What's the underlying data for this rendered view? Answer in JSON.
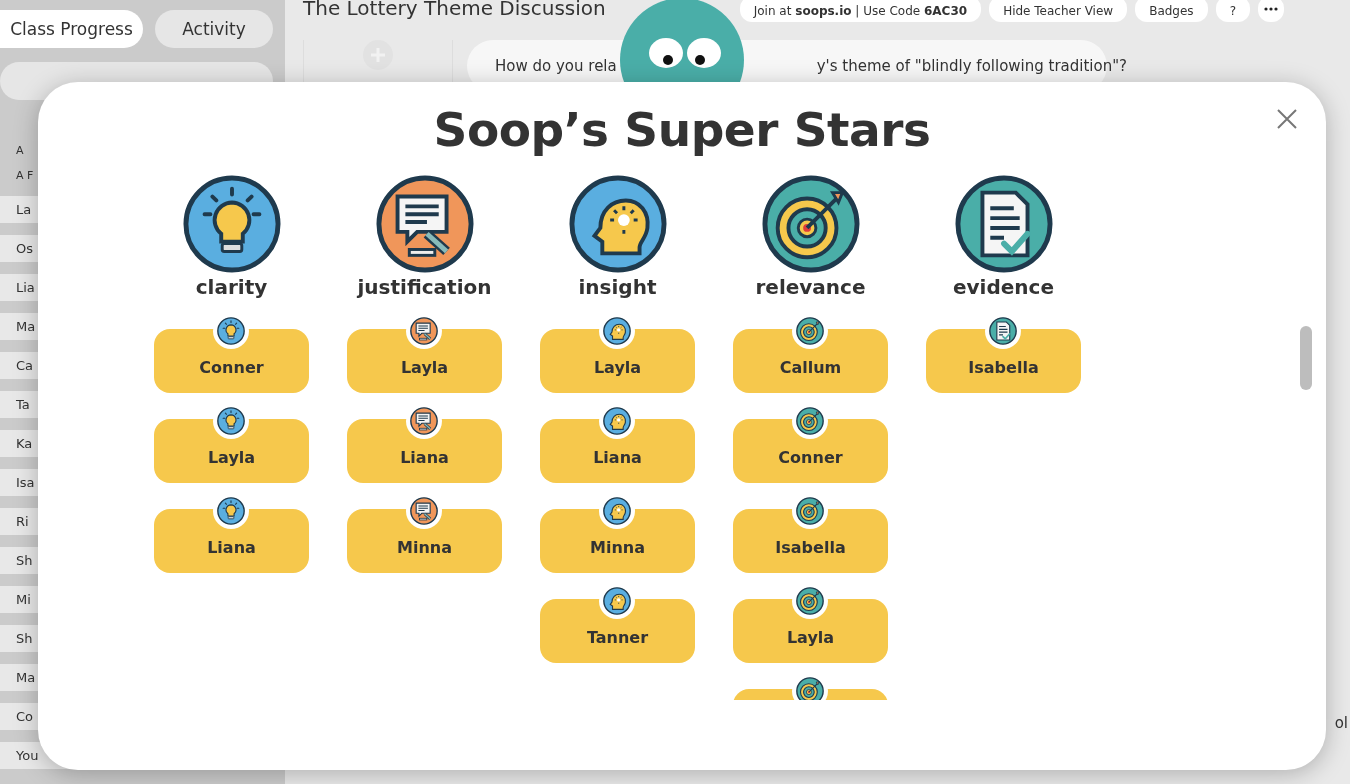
{
  "sidebar": {
    "tabs": [
      {
        "label": "Class Progress",
        "selected": true
      },
      {
        "label": "Activity",
        "selected": false
      }
    ],
    "headers": [
      "A",
      "A F"
    ],
    "students": [
      "La",
      "Os",
      "Lia",
      "Ma",
      "Ca",
      "Ta",
      "Ka",
      "Isa",
      "Ri",
      "Sh",
      "Mi",
      "Sh",
      "Ma",
      "Co",
      "You"
    ]
  },
  "page": {
    "title": "The Lottery Theme Discussion",
    "toolbar": [
      "Join at **soops.io** | Use Code **6AC30**",
      "Hide Teacher View",
      "Badges",
      "?"
    ],
    "question_parts": [
      "How do you rela",
      "y's theme of \"blindly following tradition\"?"
    ],
    "response_snippets": [
      "ol"
    ]
  },
  "modal": {
    "title": "Soop’s Super Stars",
    "categories": [
      {
        "label": "clarity",
        "kind": "bulb",
        "color": "#5aaee0",
        "students": [
          {
            "kind": "full",
            "name": "Conner"
          },
          {
            "kind": "full",
            "name": "Layla"
          },
          {
            "kind": "full",
            "name": "Liana"
          }
        ]
      },
      {
        "label": "justification",
        "kind": "gavel",
        "color": "#f0965a",
        "students": [
          {
            "kind": "full",
            "name": "Layla"
          },
          {
            "kind": "full",
            "name": "Liana"
          },
          {
            "kind": "full",
            "name": "Minna"
          }
        ]
      },
      {
        "label": "insight",
        "kind": "head",
        "color": "#5aaee0",
        "students": [
          {
            "kind": "full",
            "name": "Layla"
          },
          {
            "kind": "full",
            "name": "Liana"
          },
          {
            "kind": "full",
            "name": "Minna"
          },
          {
            "kind": "full",
            "name": "Tanner"
          }
        ]
      },
      {
        "label": "relevance",
        "kind": "target",
        "color": "#4aaea8",
        "students": [
          {
            "kind": "full",
            "name": "Callum"
          },
          {
            "kind": "full",
            "name": "Conner"
          },
          {
            "kind": "full",
            "name": "Isabella"
          },
          {
            "kind": "full",
            "name": "Layla"
          },
          {
            "kind": "clipped"
          }
        ]
      },
      {
        "label": "evidence",
        "kind": "document",
        "color": "#4aaea8",
        "students": [
          {
            "kind": "full",
            "name": "Isabella"
          }
        ]
      }
    ]
  }
}
